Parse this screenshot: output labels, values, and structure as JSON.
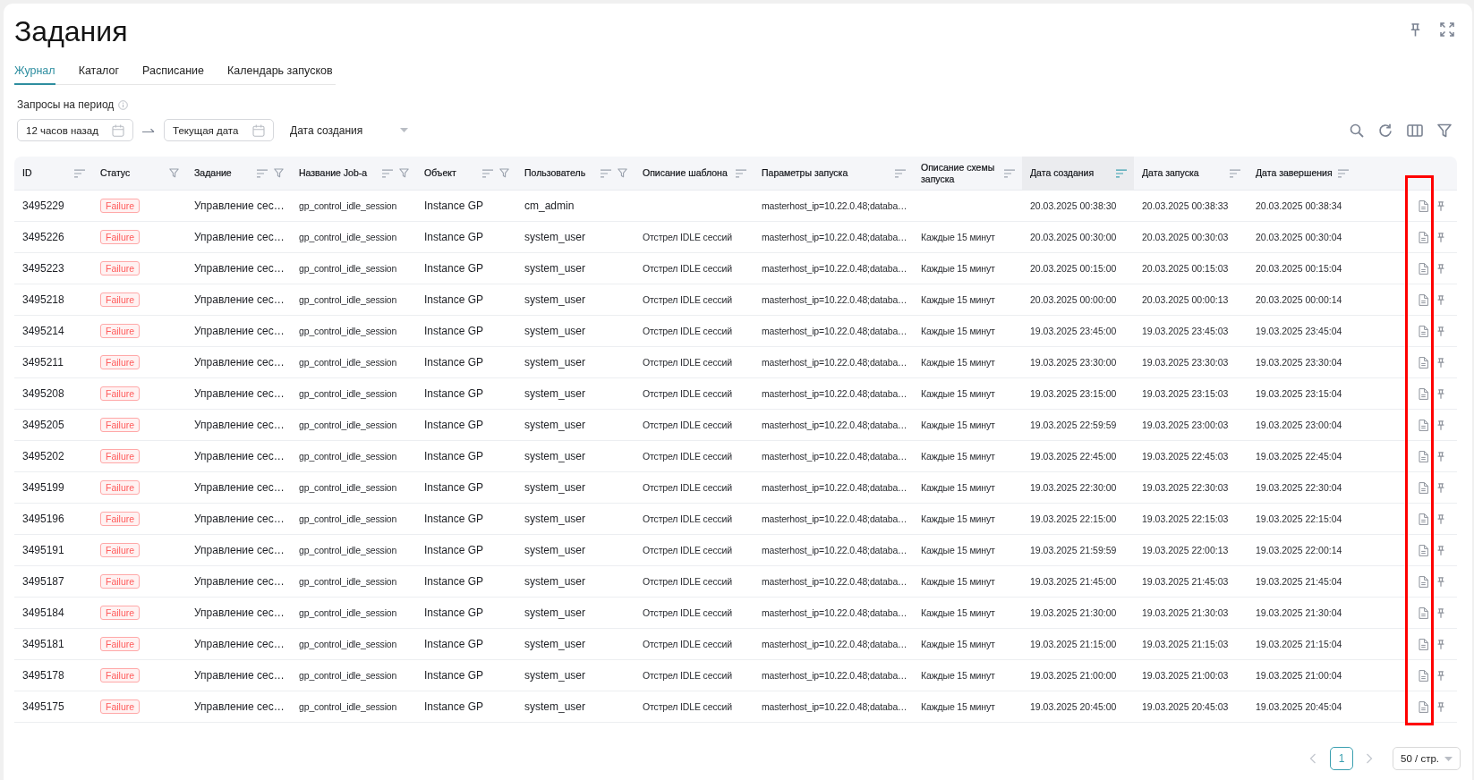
{
  "page": {
    "title": "Задания"
  },
  "tabs": [
    {
      "label": "Журнал",
      "selected": true
    },
    {
      "label": "Каталог",
      "selected": false
    },
    {
      "label": "Расписание",
      "selected": false
    },
    {
      "label": "Календарь запусков",
      "selected": false
    }
  ],
  "filters": {
    "label": "Запросы на период",
    "from": "12 часов назад",
    "to": "Текущая дата",
    "date_field": "Дата создания"
  },
  "table": {
    "columns": [
      {
        "label": "ID",
        "kind": "text",
        "sort": true,
        "filter": false,
        "sorted": false
      },
      {
        "label": "Статус",
        "kind": "status",
        "sort": false,
        "filter": true,
        "sorted": false
      },
      {
        "label": "Задание",
        "kind": "text",
        "sort": true,
        "filter": true,
        "sorted": false
      },
      {
        "label": "Название Job-а",
        "kind": "small",
        "sort": true,
        "filter": true,
        "sorted": false
      },
      {
        "label": "Объект",
        "kind": "text",
        "sort": true,
        "filter": true,
        "sorted": false
      },
      {
        "label": "Пользователь",
        "kind": "text",
        "sort": true,
        "filter": true,
        "sorted": false
      },
      {
        "label": "Описание шаблона",
        "kind": "small",
        "sort": true,
        "filter": false,
        "sorted": false
      },
      {
        "label": "Параметры запуска",
        "kind": "small",
        "sort": true,
        "filter": false,
        "sorted": false
      },
      {
        "label": "Описание схемы запуска",
        "kind": "small",
        "sort": true,
        "filter": false,
        "sorted": false
      },
      {
        "label": "Дата создания",
        "kind": "date",
        "sort": true,
        "filter": false,
        "sorted": true
      },
      {
        "label": "Дата запуска",
        "kind": "date",
        "sort": true,
        "filter": false,
        "sorted": false
      },
      {
        "label": "Дата завершения",
        "kind": "date",
        "sort": true,
        "filter": false,
        "sorted": false
      }
    ],
    "rows": [
      {
        "cells": [
          "3495229",
          "Failure",
          "Управление сес…",
          "gp_control_idle_session",
          "Instance GP",
          "cm_admin",
          null,
          "masterhost_ip=10.22.0.48;databa…",
          null,
          "20.03.2025 00:38:30",
          "20.03.2025 00:38:33",
          "20.03.2025 00:38:34"
        ]
      },
      {
        "cells": [
          "3495226",
          "Failure",
          "Управление сес…",
          "gp_control_idle_session",
          "Instance GP",
          "system_user",
          "Отстрел IDLE сессий",
          "masterhost_ip=10.22.0.48;databa…",
          "Каждые 15 минут",
          "20.03.2025 00:30:00",
          "20.03.2025 00:30:03",
          "20.03.2025 00:30:04"
        ]
      },
      {
        "cells": [
          "3495223",
          "Failure",
          "Управление сес…",
          "gp_control_idle_session",
          "Instance GP",
          "system_user",
          "Отстрел IDLE сессий",
          "masterhost_ip=10.22.0.48;databa…",
          "Каждые 15 минут",
          "20.03.2025 00:15:00",
          "20.03.2025 00:15:03",
          "20.03.2025 00:15:04"
        ]
      },
      {
        "cells": [
          "3495218",
          "Failure",
          "Управление сес…",
          "gp_control_idle_session",
          "Instance GP",
          "system_user",
          "Отстрел IDLE сессий",
          "masterhost_ip=10.22.0.48;databa…",
          "Каждые 15 минут",
          "20.03.2025 00:00:00",
          "20.03.2025 00:00:13",
          "20.03.2025 00:00:14"
        ]
      },
      {
        "cells": [
          "3495214",
          "Failure",
          "Управление сес…",
          "gp_control_idle_session",
          "Instance GP",
          "system_user",
          "Отстрел IDLE сессий",
          "masterhost_ip=10.22.0.48;databa…",
          "Каждые 15 минут",
          "19.03.2025 23:45:00",
          "19.03.2025 23:45:03",
          "19.03.2025 23:45:04"
        ]
      },
      {
        "cells": [
          "3495211",
          "Failure",
          "Управление сес…",
          "gp_control_idle_session",
          "Instance GP",
          "system_user",
          "Отстрел IDLE сессий",
          "masterhost_ip=10.22.0.48;databa…",
          "Каждые 15 минут",
          "19.03.2025 23:30:00",
          "19.03.2025 23:30:03",
          "19.03.2025 23:30:04"
        ]
      },
      {
        "cells": [
          "3495208",
          "Failure",
          "Управление сес…",
          "gp_control_idle_session",
          "Instance GP",
          "system_user",
          "Отстрел IDLE сессий",
          "masterhost_ip=10.22.0.48;databa…",
          "Каждые 15 минут",
          "19.03.2025 23:15:00",
          "19.03.2025 23:15:03",
          "19.03.2025 23:15:04"
        ]
      },
      {
        "cells": [
          "3495205",
          "Failure",
          "Управление сес…",
          "gp_control_idle_session",
          "Instance GP",
          "system_user",
          "Отстрел IDLE сессий",
          "masterhost_ip=10.22.0.48;databa…",
          "Каждые 15 минут",
          "19.03.2025 22:59:59",
          "19.03.2025 23:00:03",
          "19.03.2025 23:00:04"
        ]
      },
      {
        "cells": [
          "3495202",
          "Failure",
          "Управление сес…",
          "gp_control_idle_session",
          "Instance GP",
          "system_user",
          "Отстрел IDLE сессий",
          "masterhost_ip=10.22.0.48;databa…",
          "Каждые 15 минут",
          "19.03.2025 22:45:00",
          "19.03.2025 22:45:03",
          "19.03.2025 22:45:04"
        ]
      },
      {
        "cells": [
          "3495199",
          "Failure",
          "Управление сес…",
          "gp_control_idle_session",
          "Instance GP",
          "system_user",
          "Отстрел IDLE сессий",
          "masterhost_ip=10.22.0.48;databa…",
          "Каждые 15 минут",
          "19.03.2025 22:30:00",
          "19.03.2025 22:30:03",
          "19.03.2025 22:30:04"
        ]
      },
      {
        "cells": [
          "3495196",
          "Failure",
          "Управление сес…",
          "gp_control_idle_session",
          "Instance GP",
          "system_user",
          "Отстрел IDLE сессий",
          "masterhost_ip=10.22.0.48;databa…",
          "Каждые 15 минут",
          "19.03.2025 22:15:00",
          "19.03.2025 22:15:03",
          "19.03.2025 22:15:04"
        ]
      },
      {
        "cells": [
          "3495191",
          "Failure",
          "Управление сес…",
          "gp_control_idle_session",
          "Instance GP",
          "system_user",
          "Отстрел IDLE сессий",
          "masterhost_ip=10.22.0.48;databa…",
          "Каждые 15 минут",
          "19.03.2025 21:59:59",
          "19.03.2025 22:00:13",
          "19.03.2025 22:00:14"
        ]
      },
      {
        "cells": [
          "3495187",
          "Failure",
          "Управление сес…",
          "gp_control_idle_session",
          "Instance GP",
          "system_user",
          "Отстрел IDLE сессий",
          "masterhost_ip=10.22.0.48;databa…",
          "Каждые 15 минут",
          "19.03.2025 21:45:00",
          "19.03.2025 21:45:03",
          "19.03.2025 21:45:04"
        ]
      },
      {
        "cells": [
          "3495184",
          "Failure",
          "Управление сес…",
          "gp_control_idle_session",
          "Instance GP",
          "system_user",
          "Отстрел IDLE сессий",
          "masterhost_ip=10.22.0.48;databa…",
          "Каждые 15 минут",
          "19.03.2025 21:30:00",
          "19.03.2025 21:30:03",
          "19.03.2025 21:30:04"
        ]
      },
      {
        "cells": [
          "3495181",
          "Failure",
          "Управление сес…",
          "gp_control_idle_session",
          "Instance GP",
          "system_user",
          "Отстрел IDLE сессий",
          "masterhost_ip=10.22.0.48;databa…",
          "Каждые 15 минут",
          "19.03.2025 21:15:00",
          "19.03.2025 21:15:03",
          "19.03.2025 21:15:04"
        ]
      },
      {
        "cells": [
          "3495178",
          "Failure",
          "Управление сес…",
          "gp_control_idle_session",
          "Instance GP",
          "system_user",
          "Отстрел IDLE сессий",
          "masterhost_ip=10.22.0.48;databa…",
          "Каждые 15 минут",
          "19.03.2025 21:00:00",
          "19.03.2025 21:00:03",
          "19.03.2025 21:00:04"
        ]
      },
      {
        "cells": [
          "3495175",
          "Failure",
          "Управление сес…",
          "gp_control_idle_session",
          "Instance GP",
          "system_user",
          "Отстрел IDLE сессий",
          "masterhost_ip=10.22.0.48;databa…",
          "Каждые 15 минут",
          "19.03.2025 20:45:00",
          "19.03.2025 20:45:03",
          "19.03.2025 20:45:04"
        ]
      }
    ]
  },
  "annotations": [
    {
      "kind": "frame"
    }
  ],
  "pagination": {
    "prev_disabled": true,
    "pages": [
      {
        "label": "1",
        "selected": true
      }
    ],
    "next_disabled": true,
    "page_size": "50 / стр."
  }
}
